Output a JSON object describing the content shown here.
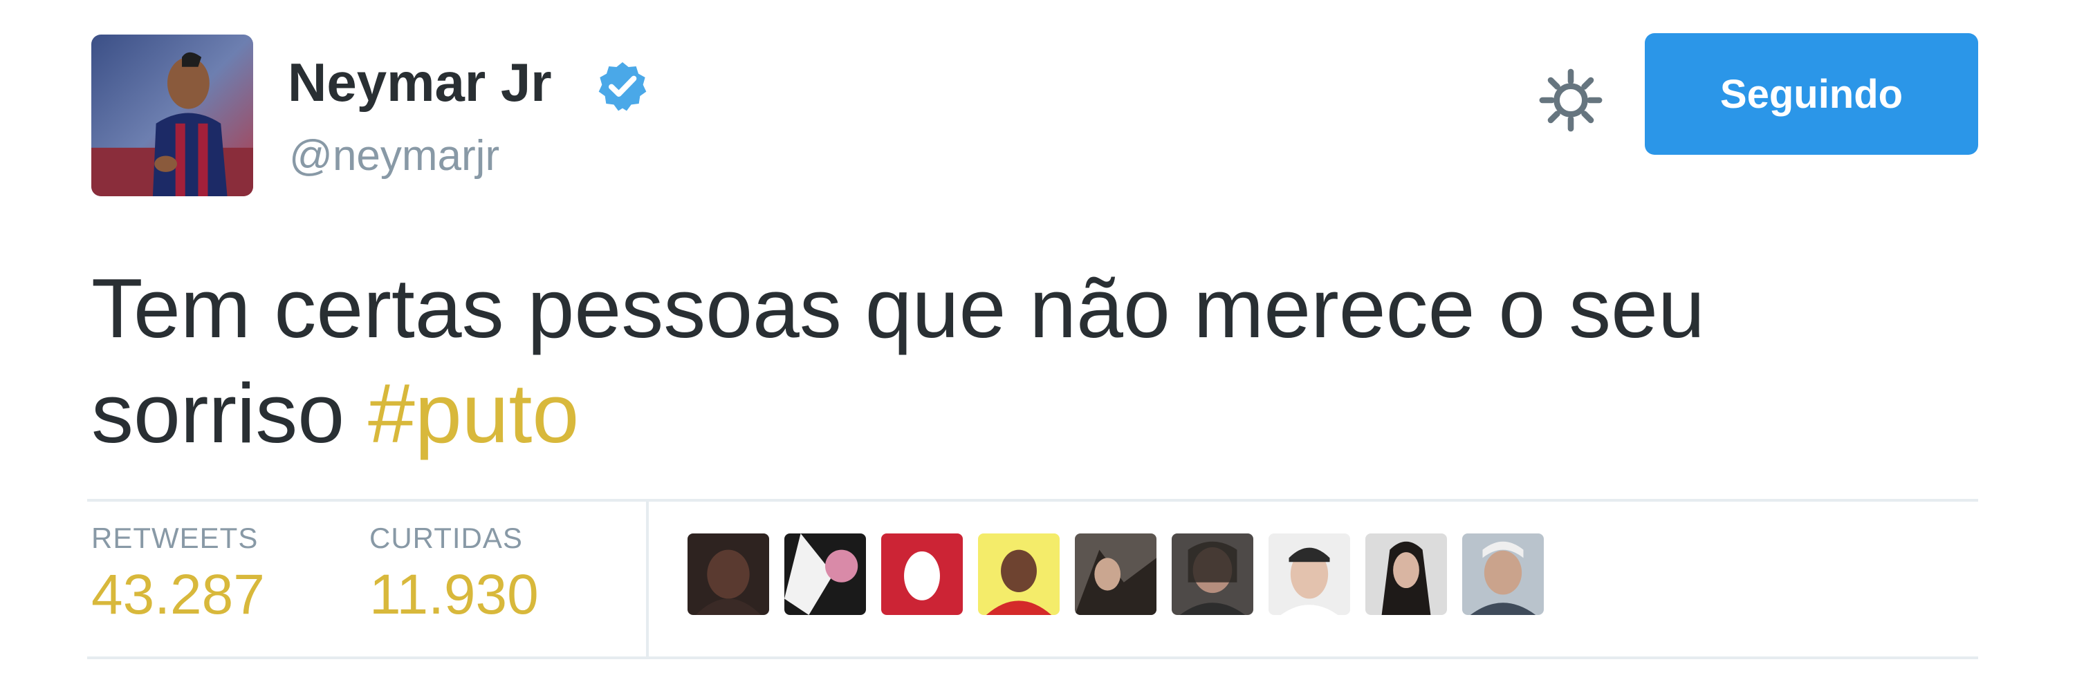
{
  "user": {
    "name": "Neymar Jr",
    "handle": "@neymarjr",
    "verified": true
  },
  "actions": {
    "follow_label": "Seguindo",
    "settings_icon": "gear-icon"
  },
  "tweet": {
    "text": "Tem certas pessoas que não merece o seu sorriso",
    "hashtag": "#puto"
  },
  "stats": {
    "retweets_label": "RETWEETS",
    "retweets_value": "43.287",
    "likes_label": "CURTIDAS",
    "likes_value": "11.930"
  },
  "likers_count_shown": 9,
  "colors": {
    "follow_button": "#2b96e8",
    "hashtag": "#d8b83b",
    "stat_value": "#d8b83b",
    "verified_badge": "#4aa8e8",
    "text": "#292f33",
    "muted": "#8899a6"
  }
}
